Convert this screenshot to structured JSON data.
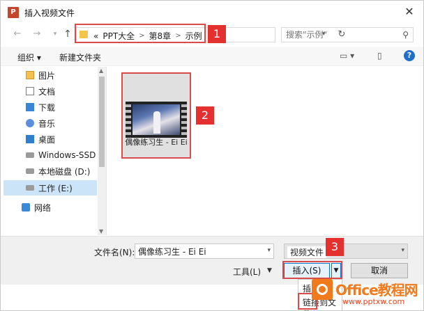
{
  "window": {
    "title": "插入视频文件",
    "app_icon": "P",
    "close_glyph": "✕"
  },
  "address": {
    "crumbs": [
      "«",
      "PPT大全",
      "第8章",
      "示例"
    ],
    "search_placeholder": "搜索\"示例\""
  },
  "toolbar": {
    "organize": "组织 ▾",
    "new_folder": "新建文件夹",
    "help_glyph": "?"
  },
  "sidebar": {
    "items": [
      {
        "label": "图片",
        "icon": "picture-folder-icon"
      },
      {
        "label": "文档",
        "icon": "document-folder-icon"
      },
      {
        "label": "下载",
        "icon": "download-folder-icon"
      },
      {
        "label": "音乐",
        "icon": "music-folder-icon"
      },
      {
        "label": "桌面",
        "icon": "desktop-folder-icon"
      },
      {
        "label": "Windows-SSD (",
        "icon": "drive-icon"
      },
      {
        "label": "本地磁盘 (D:)",
        "icon": "drive-icon"
      },
      {
        "label": "工作 (E:)",
        "icon": "drive-icon",
        "selected": true
      },
      {
        "label": "网络",
        "icon": "network-icon"
      }
    ]
  },
  "files": [
    {
      "name": "偶像练习生 - Ei Ei",
      "type": "video"
    }
  ],
  "badges": [
    "1",
    "2",
    "3"
  ],
  "footer": {
    "filename_label": "文件名(N):",
    "filename_value": "偶像练习生 - Ei Ei",
    "filetype_value": "视频文件",
    "tools_label": "工具(L)",
    "insert_label": "插入(S)",
    "cancel_label": "取消"
  },
  "insert_menu": {
    "items": [
      "插入",
      "链接到文件"
    ]
  },
  "watermark": {
    "title": "Office教程网",
    "url": "www.pptxw.com"
  },
  "colors": {
    "highlight": "#d94b4b",
    "badge": "#e53030",
    "selection": "#cce4f7",
    "accent": "#0078d7"
  }
}
